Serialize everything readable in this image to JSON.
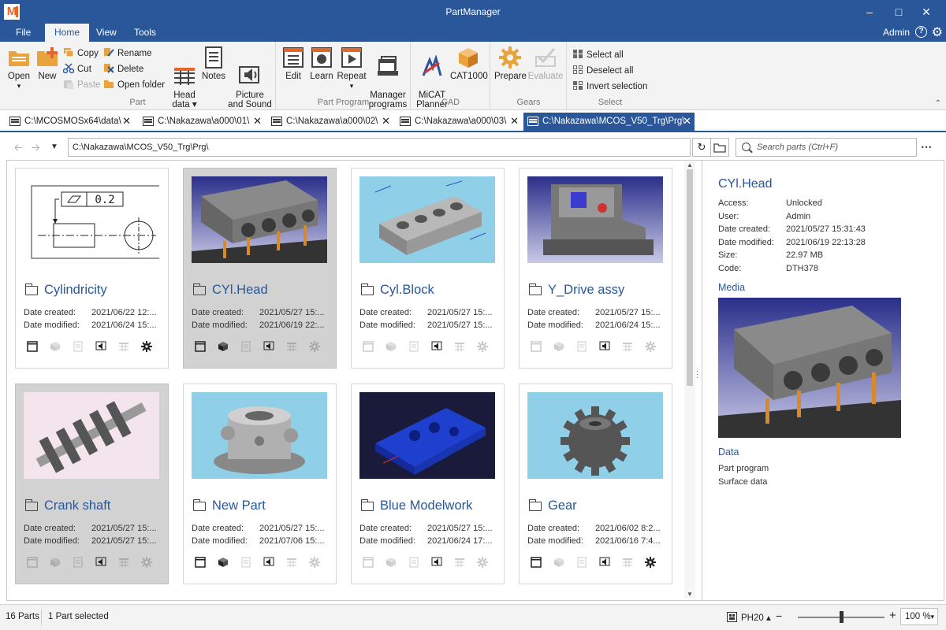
{
  "window": {
    "logo": "M",
    "title": "PartManager"
  },
  "menu": {
    "tabs": [
      {
        "label": "File"
      },
      {
        "label": "Home"
      },
      {
        "label": "View"
      },
      {
        "label": "Tools"
      }
    ],
    "user": "Admin",
    "help": "?"
  },
  "ribbon": {
    "part": {
      "label": "Part",
      "open": "Open",
      "new": "New",
      "copy": "Copy",
      "cut": "Cut",
      "paste": "Paste",
      "rename": "Rename",
      "delete": "Delete",
      "open_folder": "Open folder",
      "head_data": "Head\ndata ▾",
      "notes": "Notes",
      "picture_sound": "Picture\nand Sound"
    },
    "program": {
      "label": "Part Program",
      "edit": "Edit",
      "learn": "Learn",
      "repeat": "Repeat",
      "manager": "Manager\nprograms"
    },
    "cad": {
      "label": "CAD",
      "micat": "MiCAT\nPlanner",
      "cat1000": "CAT1000"
    },
    "gears": {
      "label": "Gears",
      "prepare": "Prepare",
      "evaluate": "Evaluate"
    },
    "select": {
      "label": "Select",
      "select_all": "Select all",
      "deselect_all": "Deselect all",
      "invert": "Invert selection"
    }
  },
  "doc_tabs": [
    {
      "label": "C:\\MCOSMOSx64\\data\\"
    },
    {
      "label": "C:\\Nakazawa\\a000\\01\\"
    },
    {
      "label": "C:\\Nakazawa\\a000\\02\\"
    },
    {
      "label": "C:\\Nakazawa\\a000\\03\\"
    },
    {
      "label": "C:\\Nakazawa\\MCOS_V50_Trg\\Prg\\"
    }
  ],
  "address": {
    "path": "C:\\Nakazawa\\MCOS_V50_Trg\\Prg\\",
    "search_placeholder": "Search parts (Ctrl+F)"
  },
  "labels": {
    "date_created": "Date created:",
    "date_modified": "Date modified:"
  },
  "parts": [
    {
      "name": "Cylindricity",
      "created": "2021/06/22 12:...",
      "modified": "2021/06/24 15:...",
      "selected": false,
      "flags": [
        true,
        false,
        false,
        true,
        false,
        true
      ]
    },
    {
      "name": "CYl.Head",
      "created": "2021/05/27 15:...",
      "modified": "2021/06/19 22:...",
      "selected": true,
      "flags": [
        true,
        true,
        false,
        true,
        false,
        false
      ]
    },
    {
      "name": "Cyl.Block",
      "created": "2021/05/27 15:...",
      "modified": "2021/05/27 15:...",
      "selected": false,
      "flags": [
        false,
        false,
        false,
        true,
        false,
        false
      ]
    },
    {
      "name": "Y_Drive assy",
      "created": "2021/05/27 15:...",
      "modified": "2021/06/24 15:...",
      "selected": false,
      "flags": [
        false,
        false,
        false,
        true,
        false,
        false
      ]
    },
    {
      "name": "Crank shaft",
      "created": "2021/05/27 15:...",
      "modified": "2021/05/27 15:...",
      "selected": true,
      "flags": [
        false,
        false,
        false,
        true,
        false,
        false
      ]
    },
    {
      "name": "New Part",
      "created": "2021/05/27 15:...",
      "modified": "2021/07/06 15:...",
      "selected": false,
      "flags": [
        true,
        true,
        false,
        true,
        false,
        false
      ]
    },
    {
      "name": "Blue Modelwork",
      "created": "2021/05/27 15:...",
      "modified": "2021/06/24 17:...",
      "selected": false,
      "flags": [
        false,
        false,
        false,
        true,
        false,
        false
      ]
    },
    {
      "name": "Gear",
      "created": "2021/06/02 8:2...",
      "modified": "2021/06/16 7:4...",
      "selected": false,
      "flags": [
        true,
        false,
        false,
        true,
        false,
        true
      ]
    }
  ],
  "drawing_tolerance": "0.2",
  "details": {
    "title": "CYl.Head",
    "fields": [
      {
        "label": "Access:",
        "value": "Unlocked"
      },
      {
        "label": "User:",
        "value": "Admin"
      },
      {
        "label": "Date created:",
        "value": "2021/05/27 15:31:43"
      },
      {
        "label": "Date modified:",
        "value": "2021/06/19 22:13:28"
      },
      {
        "label": "Size:",
        "value": "22.97 MB"
      },
      {
        "label": "Code:",
        "value": "DTH378"
      }
    ],
    "media_label": "Media",
    "data_label": "Data",
    "data_items": [
      "Part program",
      "Surface data"
    ]
  },
  "status": {
    "count": "16 Parts",
    "selection": "1 Part selected",
    "probe": "PH20 ▴",
    "zoom_out": "−",
    "zoom_in": "+",
    "zoom": "100 %",
    "zoom_level": 0.5
  },
  "colors": {
    "accent": "#2a579a",
    "ribbon_bg": "#f3f3f3",
    "selected_card": "#d2d2d2",
    "orange": "#e4662a"
  }
}
